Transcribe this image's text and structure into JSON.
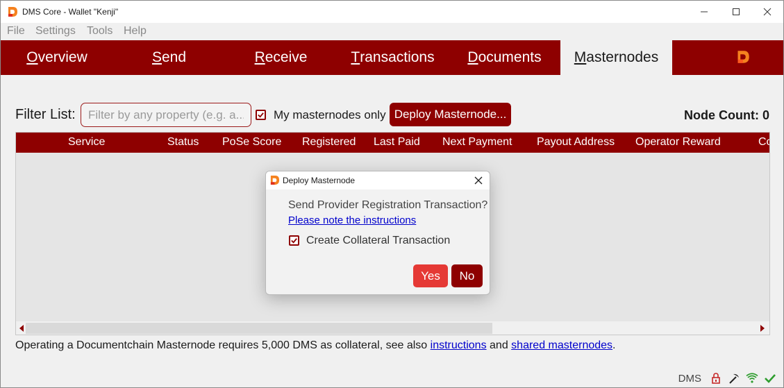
{
  "window": {
    "title": "DMS Core - Wallet \"Kenji\""
  },
  "menu": [
    "File",
    "Settings",
    "Tools",
    "Help"
  ],
  "tabs": [
    {
      "mnemonic": "O",
      "rest": "verview"
    },
    {
      "mnemonic": "S",
      "rest": "end"
    },
    {
      "mnemonic": "R",
      "rest": "eceive"
    },
    {
      "mnemonic": "T",
      "rest": "ransactions"
    },
    {
      "mnemonic": "D",
      "rest": "ocuments"
    },
    {
      "mnemonic": "M",
      "rest": "asternodes"
    }
  ],
  "active_tab": "Masternodes",
  "filter": {
    "label": "Filter List:",
    "placeholder": "Filter by any property (e.g. a...",
    "value": "",
    "my_masternodes_only_label": "My masternodes only",
    "my_masternodes_only_checked": true,
    "deploy_button": "Deploy Masternode..."
  },
  "node_count": {
    "label": "Node Count:",
    "value": "0"
  },
  "table": {
    "columns": [
      "Service",
      "Status",
      "PoSe Score",
      "Registered",
      "Last Paid",
      "Next Payment",
      "Payout Address",
      "Operator Reward",
      "Co"
    ],
    "rows": []
  },
  "footnote": {
    "text_before": "Operating a Documentchain Masternode requires 5,000 DMS as collateral, see also ",
    "link1": "instructions",
    "text_middle": " and ",
    "link2": "shared masternodes",
    "text_after": "."
  },
  "statusbar": {
    "unit": "DMS",
    "icons": [
      "lock-icon",
      "pickaxe-icon",
      "network-signal-icon",
      "sync-check-icon"
    ]
  },
  "dialog": {
    "title": "Deploy Masternode",
    "question": "Send Provider Registration Transaction?",
    "link": "Please note the instructions",
    "checkbox_label": "Create Collateral Transaction",
    "checkbox_checked": true,
    "yes": "Yes",
    "no": "No"
  },
  "colors": {
    "brand_dark_red": "#8e0000",
    "yes_red": "#e53935",
    "link_blue": "#0000cc",
    "logo_orange": "#f5821f"
  }
}
